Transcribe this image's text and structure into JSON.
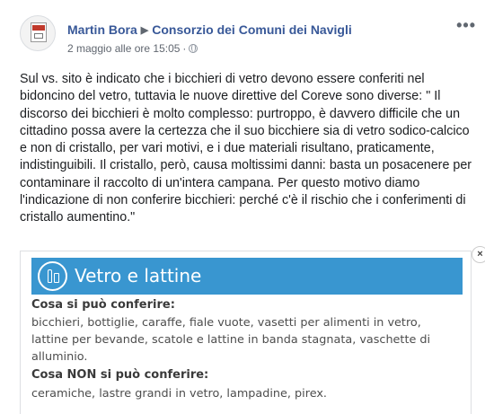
{
  "post": {
    "author": "Martin Bora",
    "target_page": "Consorzio dei Comuni dei Navigli",
    "separator_icon": "triangle-right-icon",
    "timestamp": "2 maggio alle ore 15:05",
    "meta_dot": "·",
    "privacy_icon": "globe-icon",
    "more_icon": "•••",
    "text": "Sul vs. sito è indicato che i bicchieri di vetro devono essere conferiti nel bidoncino del vetro, tuttavia le nuove direttive del Coreve sono diverse: \" Il discorso dei bicchieri è molto complesso: purtroppo, è davvero difficile che un cittadino possa avere la certezza che il suo bicchiere sia di vetro sodico-calcico e non di cristallo, per vari motivi, e i due materiali risultano, praticamente, indistinguibili. Il cristallo, però, causa moltissimi danni: basta un posacenere per contaminare il raccolto di un'intera campana. Per questo motivo diamo l'indicazione di non conferire bicchieri: perché c'è il rischio che i conferimenti di cristallo aumentino.\""
  },
  "attachment": {
    "banner_title": "Vetro e lattine",
    "banner_color": "#3996d0",
    "close_icon": "×",
    "section1_title": "Cosa si può conferire:",
    "section1_text": "bicchieri, bottiglie, caraffe, fiale vuote, vasetti per alimenti in vetro, lattine per bevande, scatole e lattine in banda stagnata, vaschette di alluminio.",
    "section2_title": "Cosa NON si può conferire:",
    "section2_text": "ceramiche, lastre grandi in vetro, lampadine, pirex."
  },
  "colors": {
    "link": "#385898",
    "text": "#1c1e21",
    "meta": "#616770"
  }
}
